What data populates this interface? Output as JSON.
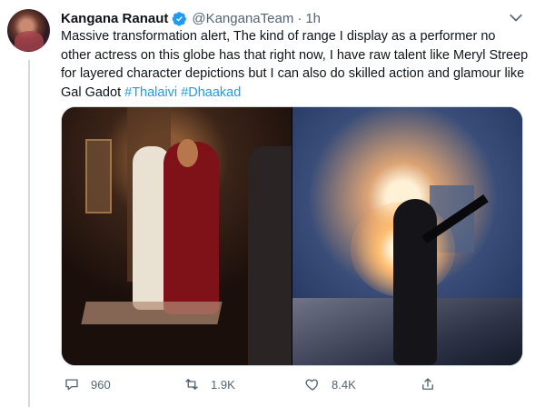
{
  "tweet": {
    "author_name": "Kangana Ranaut",
    "author_handle": "@KanganaTeam",
    "separator": "·",
    "time": "1h",
    "text_before_hashtags": "Massive transformation alert, The kind of range I display as a performer no other actress on this globe has that right now, I have raw talent like Meryl Streep for layered character depictions but I can also do skilled action and glamour like Gal Gadot ",
    "hashtags": [
      "#Thalaivi",
      "#Dhaakad"
    ],
    "icons": {
      "verified": "verified-icon",
      "more": "more-caret-icon",
      "reply": "reply-icon",
      "retweet": "retweet-icon",
      "like": "like-icon",
      "share": "share-icon"
    }
  },
  "actions": {
    "replies": "960",
    "retweets": "1.9K",
    "likes": "8.4K"
  },
  "colors": {
    "text": "#0f1419",
    "secondary": "#536471",
    "hashtag": "#1d9bf0",
    "verified": "#1d9bf0",
    "border": "#cfd9de"
  }
}
